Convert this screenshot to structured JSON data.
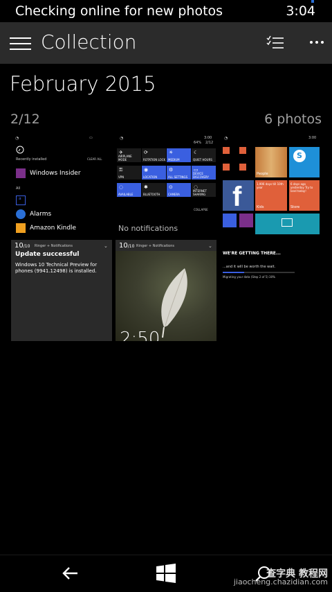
{
  "status": {
    "text": "Checking online for new photos",
    "time": "3:04"
  },
  "appbar": {
    "title": "Collection"
  },
  "section": {
    "month": "February 2015",
    "date": "2/12",
    "count": "6 photos"
  },
  "thumbs": {
    "t1": {
      "recently_installed": "Recently installed",
      "clear_all": "CLEAR ALL",
      "windows_insider": "Windows Insider",
      "all": "All",
      "letter": "a",
      "alarms": "Alarms",
      "amazon_kindle": "Amazon Kindle"
    },
    "t2": {
      "time": "3:00",
      "date": "2/12",
      "battery": "64%",
      "tiles": [
        "AIRPLANE MODE",
        "ROTATION LOCK",
        "MEDIUM",
        "QUIET HOURS",
        "VPN",
        "LOCATION",
        "ALL SETTINGS",
        "DEVICE DISCOVERY",
        "AVAILABLE",
        "BLUETOOTH",
        "CAMERA",
        "INTERNET SHARING"
      ],
      "collapse": "COLLAPSE",
      "no_notifications": "No notifications"
    },
    "t3": {
      "time": "3:00",
      "people": "People",
      "store": "Store",
      "kids": "Kids",
      "facebook_glyph": "f",
      "countdown": "1,906 days till 10th year",
      "skype_text": "6 days 11:58 AM Ctrl here.",
      "days_ago": "6 days ago yesterday Try to land today!"
    },
    "t4": {
      "time": "10",
      "suffix": "/10",
      "title": "Ringer + Notifications",
      "headline": "Update successful",
      "body": "Windows 10 Technical Preview for phones (9941.12498) is installed."
    },
    "t5": {
      "time": "10",
      "suffix": "/10",
      "title": "Ringer + Notifications",
      "clock": "2:50"
    },
    "t6": {
      "headline": "WE'RE GETTING THERE...",
      "sub": "...and it will be worth the wait.",
      "progress_label": "Migrating your data (Step 2 of 5) 30%",
      "progress": 0.3
    }
  },
  "watermark": {
    "line1": "查字典 教程网",
    "line2": "jiaocheng.chazidian.com"
  },
  "colors": {
    "accent": "#3a5fe0",
    "tile_orange": "#e0603a",
    "appbar": "#2b2b2b"
  }
}
